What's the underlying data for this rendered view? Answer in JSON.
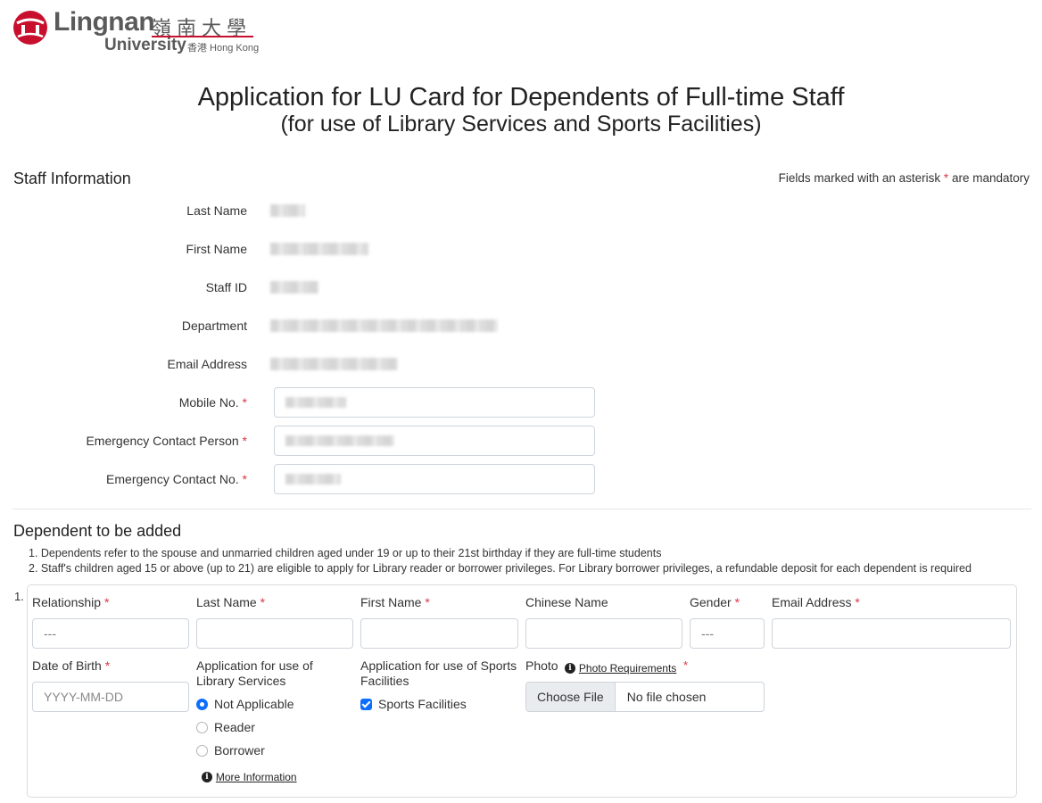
{
  "logo": {
    "name_en": "Lingnan",
    "name_cn": "嶺南大學",
    "university": "University",
    "location": "香港 Hong Kong"
  },
  "header": {
    "title_line1": "Application for LU Card for Dependents of Full-time Staff",
    "title_line2": "(for use of Library Services and Sports Facilities)"
  },
  "staff_section": {
    "title": "Staff Information",
    "mandatory_note_prefix": "Fields marked with an asterisk",
    "mandatory_note_star": "*",
    "mandatory_note_suffix": "are mandatory",
    "fields": {
      "last_name_label": "Last Name",
      "first_name_label": "First Name",
      "staff_id_label": "Staff ID",
      "department_label": "Department",
      "email_label": "Email Address",
      "mobile_label": "Mobile No.",
      "emergency_person_label": "Emergency Contact Person",
      "emergency_no_label": "Emergency Contact No."
    },
    "required_mark": "*"
  },
  "dependent_section": {
    "title": "Dependent to be added",
    "note1": "1. Dependents refer to the spouse and unmarried children aged under 19 or up to their 21st birthday if they are full-time students",
    "note2": "2. Staff's children aged 15 or above (up to 21) are eligible to apply for Library reader or borrower privileges. For Library borrower privileges, a refundable deposit for each dependent is required",
    "entry_number": "1.",
    "relationship_label": "Relationship",
    "relationship_value": "---",
    "last_name_label": "Last Name",
    "first_name_label": "First Name",
    "chinese_name_label": "Chinese Name",
    "gender_label": "Gender",
    "gender_value": "---",
    "email_label": "Email Address",
    "dob_label": "Date of Birth",
    "dob_placeholder": "YYYY-MM-DD",
    "library_label": "Application for use of Library Services",
    "library_options": [
      "Not Applicable",
      "Reader",
      "Borrower"
    ],
    "library_selected": "Not Applicable",
    "more_info": "More Information",
    "sports_label": "Application for use of Sports Facilities",
    "sports_option": "Sports Facilities",
    "photo_label": "Photo",
    "photo_requirements": "Photo Requirements",
    "choose_file": "Choose File",
    "no_file": "No file chosen"
  },
  "colors": {
    "required": "#dc3545",
    "accent": "#0d6efd",
    "logo_red": "#c8102e"
  }
}
